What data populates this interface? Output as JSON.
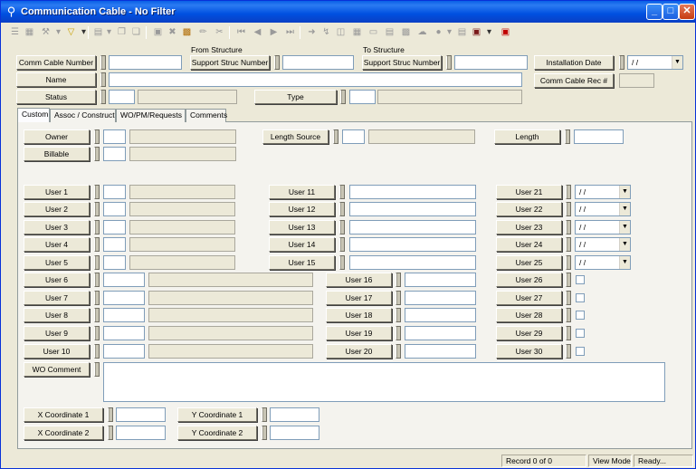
{
  "window": {
    "title": "Communication Cable - No Filter"
  },
  "header": {
    "from_structure": "From Structure",
    "to_structure": "To Structure",
    "comm_cable_number": "Comm Cable Number",
    "support_struc_from": "Support Struc Number",
    "support_struc_to": "Support Struc Number",
    "installation_date": "Installation Date",
    "installation_date_value": "/ /",
    "name": "Name",
    "comm_cable_rec": "Comm Cable Rec #",
    "status": "Status",
    "type": "Type"
  },
  "tabs": [
    {
      "label": "Custom"
    },
    {
      "label": "Assoc / Construct"
    },
    {
      "label": "WO/PM/Requests"
    },
    {
      "label": "Comments"
    }
  ],
  "custom": {
    "owner": "Owner",
    "billable": "Billable",
    "length_source": "Length Source",
    "length": "Length",
    "users_col1": [
      "User 1",
      "User 2",
      "User 3",
      "User 4",
      "User 5",
      "User 6",
      "User 7",
      "User 8",
      "User 9",
      "User 10"
    ],
    "users_col2": [
      "User 11",
      "User 12",
      "User 13",
      "User 14",
      "User 15",
      "User 16",
      "User 17",
      "User 18",
      "User 19",
      "User 20"
    ],
    "users_col3": [
      "User 21",
      "User 22",
      "User 23",
      "User 24",
      "User 25",
      "User 26",
      "User 27",
      "User 28",
      "User 29",
      "User 30"
    ],
    "date_value": "/ /",
    "wo_comment": "WO Comment",
    "x_coord_1": "X Coordinate 1",
    "x_coord_2": "X Coordinate 2",
    "y_coord_1": "Y Coordinate 1",
    "y_coord_2": "Y Coordinate 2"
  },
  "status": {
    "record": "Record 0 of 0",
    "mode": "View Mode",
    "state": "Ready..."
  },
  "colors": {
    "titlebar": "#0054e3",
    "face": "#ece9d8",
    "field_border": "#7f9db9"
  }
}
